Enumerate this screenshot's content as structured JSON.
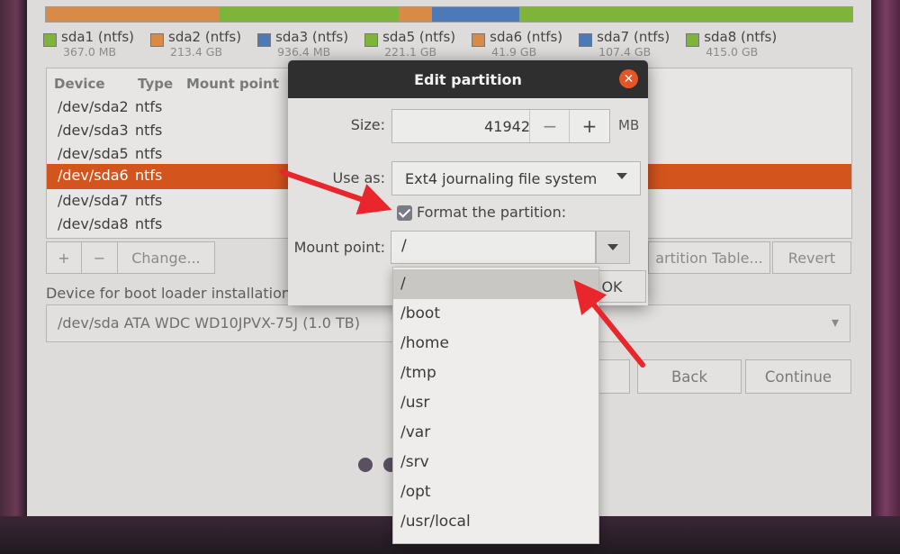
{
  "partition_bar": {
    "colors": [
      "#7fb43a",
      "#d98a46",
      "#4d79b8",
      "#7fb43a",
      "#d98a46",
      "#4d79b8",
      "#7fb43a"
    ]
  },
  "legend": [
    {
      "name": "sda1 (ntfs)",
      "size": "367.0 MB",
      "color": "#7fb43a"
    },
    {
      "name": "sda2 (ntfs)",
      "size": "213.4 GB",
      "color": "#d98a46"
    },
    {
      "name": "sda3 (ntfs)",
      "size": "936.4 MB",
      "color": "#4d79b8"
    },
    {
      "name": "sda5 (ntfs)",
      "size": "221.1 GB",
      "color": "#7fb43a"
    },
    {
      "name": "sda6 (ntfs)",
      "size": "41.9 GB",
      "color": "#d98a46"
    },
    {
      "name": "sda7 (ntfs)",
      "size": "107.4 GB",
      "color": "#4d79b8"
    },
    {
      "name": "sda8 (ntfs)",
      "size": "415.0 GB",
      "color": "#7fb43a"
    }
  ],
  "table": {
    "headers": {
      "device": "Device",
      "type": "Type",
      "mount": "Mount point"
    },
    "rows": [
      {
        "device": "/dev/sda2",
        "type": "ntfs",
        "selected": false
      },
      {
        "device": "/dev/sda3",
        "type": "ntfs",
        "selected": false
      },
      {
        "device": "/dev/sda5",
        "type": "ntfs",
        "selected": false
      },
      {
        "device": "/dev/sda6",
        "type": "ntfs",
        "selected": true
      },
      {
        "device": "/dev/sda7",
        "type": "ntfs",
        "selected": false
      },
      {
        "device": "/dev/sda8",
        "type": "ntfs",
        "selected": false
      }
    ]
  },
  "toolbar": {
    "add": "+",
    "remove": "−",
    "change": "Change...",
    "new_table": "artition Table...",
    "revert": "Revert"
  },
  "boot": {
    "label": "Device for boot loader installation:",
    "device": "/dev/sda   ATA WDC WD10JPVX-75J (1.0 TB)",
    "arrow": "▾"
  },
  "nav": {
    "back": "Back",
    "continue": "Continue"
  },
  "dialog": {
    "title": "Edit partition",
    "close": "✕",
    "size_label": "Size:",
    "size_value": "41942",
    "minus": "−",
    "plus": "+",
    "unit": "MB",
    "use_as_label": "Use as:",
    "use_as_value": "Ext4 journaling file system",
    "format_label": "Format the partition:",
    "format_checked": true,
    "mount_label": "Mount point:",
    "mount_value": "/",
    "ok": "OK"
  },
  "mount_options": [
    "/",
    "/boot",
    "/home",
    "/tmp",
    "/usr",
    "/var",
    "/srv",
    "/opt",
    "/usr/local"
  ],
  "highlighted_option": "/",
  "annotation_color": "#e8262b"
}
